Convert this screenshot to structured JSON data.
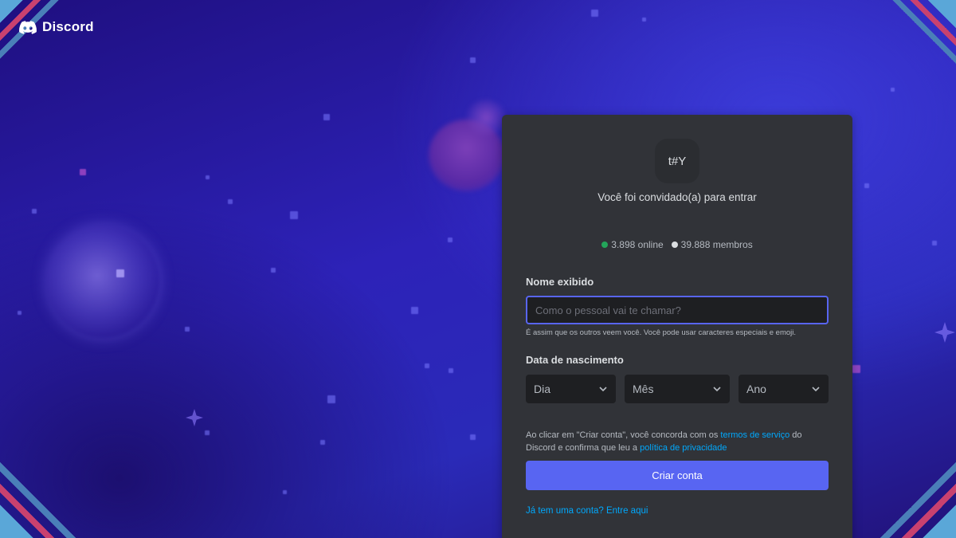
{
  "logo": {
    "text": "Discord"
  },
  "invite": {
    "server_icon_text": "t#Y",
    "message": "Você foi convidado(a) para entrar",
    "online": "3.898 online",
    "members": "39.888 membros"
  },
  "form": {
    "display_name": {
      "label": "Nome exibido",
      "placeholder": "Como o pessoal vai te chamar?",
      "value": "",
      "hint": "É assim que os outros veem você. Você pode usar caracteres especiais e emoji."
    },
    "birth_date": {
      "label": "Data de nascimento",
      "day": "Dia",
      "month": "Mês",
      "year": "Ano"
    },
    "terms": {
      "prefix": "Ao clicar em \"Criar conta\", você concorda com os ",
      "tos_link": "termos de serviço",
      "middle": " do Discord e confirma que leu a ",
      "privacy_link": "política de privacidade"
    },
    "create_button": "Criar conta",
    "login_link": "Já tem uma conta? Entre aqui"
  },
  "colors": {
    "accent": "#5865f2",
    "online": "#23a55a",
    "link": "#00a8fc",
    "card": "#313338"
  }
}
